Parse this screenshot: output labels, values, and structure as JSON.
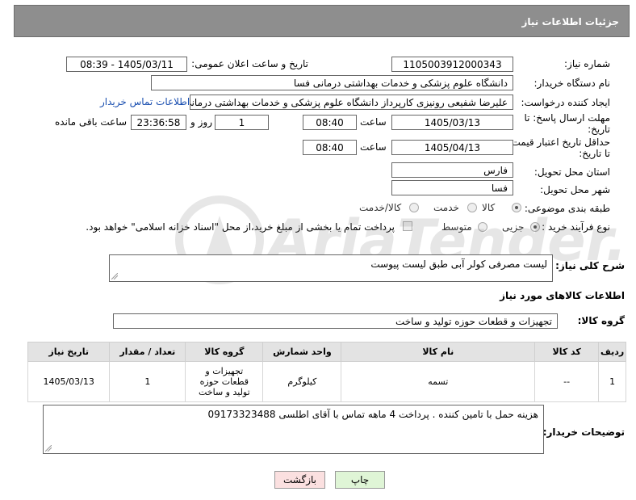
{
  "panel_title": "جزئیات اطلاعات نیاز",
  "need_number": {
    "label": "شماره نیاز:",
    "value": "1105003912000343"
  },
  "announce_datetime": {
    "label": "تاریخ و ساعت اعلان عمومی:",
    "value": "1405/03/11 - 08:39"
  },
  "buyer_org": {
    "label": "نام دستگاه خریدار:",
    "value": "دانشگاه علوم پزشکی و خدمات بهداشتی درمانی فسا"
  },
  "requester": {
    "label": "ایجاد کننده درخواست:",
    "value": "علیرضا شفیعی رونیزی کارپرداز دانشگاه علوم پزشکی و خدمات بهداشتی درمانی",
    "contact_link": "اطلاعات تماس خریدار"
  },
  "reply_deadline": {
    "label_line1": "مهلت ارسال پاسخ: تا",
    "label_line2": "تاریخ:",
    "date": "1405/03/13",
    "time_label": "ساعت",
    "time": "08:40",
    "days": "1",
    "days_label": "روز و",
    "remaining": "23:36:58",
    "remaining_label": "ساعت باقی مانده"
  },
  "price_validity": {
    "label_line1": "حداقل تاریخ اعتبار قیمت:",
    "label_line2": "تا تاریخ:",
    "date": "1405/04/13",
    "time_label": "ساعت",
    "time": "08:40"
  },
  "province": {
    "label": "استان محل تحویل:",
    "value": "فارس"
  },
  "city": {
    "label": "شهر محل تحویل:",
    "value": "فسا"
  },
  "category": {
    "label": "طبقه بندی موضوعی:",
    "options": [
      "کالا",
      "خدمت",
      "کالا/خدمت"
    ],
    "selected": "کالا"
  },
  "purchase_process": {
    "label": "نوع فرآیند خرید :",
    "options": [
      "جزیی",
      "متوسط"
    ],
    "selected": "جزیی",
    "note": "پرداخت تمام یا بخشی از مبلغ خرید،از محل \"اسناد خزانه اسلامی\" خواهد بود."
  },
  "summary": {
    "label": "شرح کلی نیاز:",
    "value": "لیست مصرفی کولر آبی طبق لیست پیوست"
  },
  "items_section_title": "اطلاعات کالاهای مورد نیاز",
  "goods_group": {
    "label": "گروه کالا:",
    "value": "تجهیزات و قطعات حوزه تولید و ساخت"
  },
  "table": {
    "headers": [
      "ردیف",
      "کد کالا",
      "نام کالا",
      "واحد شمارش",
      "گروه کالا",
      "تعداد / مقدار",
      "تاریخ نیاز"
    ],
    "rows": [
      [
        "1",
        "--",
        "تسمه",
        "کیلوگرم",
        "تجهیزات و قطعات حوزه تولید و ساخت",
        "1",
        "1405/03/13"
      ]
    ]
  },
  "buyer_notes": {
    "label": "توضیحات خریدار:",
    "value": "هزینه حمل با تامین کننده . پرداخت 4 ماهه تماس با آقای اطلسی 09173323488"
  },
  "buttons": {
    "print": "چاپ",
    "back": "بازگشت"
  },
  "colors": {
    "title_bar": "#8e8e8e",
    "link": "#1a4fb0",
    "print_btn": "#dff5d6",
    "back_btn": "#fbe0e0"
  }
}
